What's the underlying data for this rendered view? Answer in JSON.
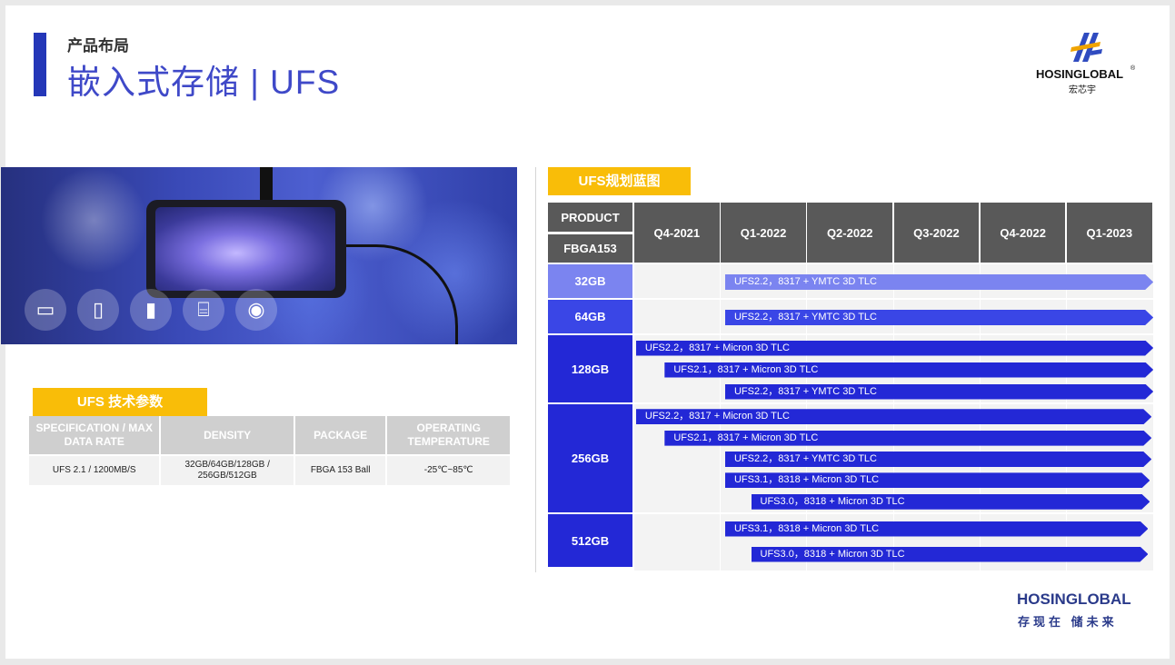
{
  "header": {
    "subtitle": "产品布局",
    "title": "嵌入式存储 | UFS"
  },
  "logo": {
    "brand": "HOSINGLOBAL",
    "registered": "®",
    "chinese": "宏芯宇"
  },
  "spec_section": {
    "tag": "UFS 技术参数",
    "columns": [
      "SPECIFICATION / MAX DATA RATE",
      "DENSITY",
      "PACKAGE",
      "OPERATING TEMPERATURE"
    ],
    "row": [
      "UFS 2.1 / 1200MB/S",
      "32GB/64GB/128GB / 256GB/512GB",
      "FBGA 153 Ball",
      "-25℃~85℃"
    ]
  },
  "roadmap": {
    "tag": "UFS规划蓝图",
    "product_label": "PRODUCT",
    "package_label": "FBGA153",
    "quarters": [
      "Q4-2021",
      "Q1-2022",
      "Q2-2022",
      "Q3-2022",
      "Q4-2022",
      "Q1-2023"
    ],
    "rows": [
      {
        "density": "32GB",
        "bars": [
          {
            "label": "UFS2.2，8317 + YMTC 3D TLC",
            "start": 1.05,
            "end": 6.0
          }
        ]
      },
      {
        "density": "64GB",
        "bars": [
          {
            "label": "UFS2.2，8317 + YMTC 3D TLC",
            "start": 1.05,
            "end": 6.0
          }
        ]
      },
      {
        "density": "128GB",
        "bars": [
          {
            "label": "UFS2.2，8317 + Micron 3D TLC",
            "start": 0.02,
            "end": 6.0
          },
          {
            "label": "UFS2.1，8317 + Micron 3D TLC",
            "start": 0.35,
            "end": 6.0
          },
          {
            "label": "UFS2.2，8317 + YMTC 3D TLC",
            "start": 1.05,
            "end": 6.0
          }
        ]
      },
      {
        "density": "256GB",
        "bars": [
          {
            "label": "UFS2.2，8317 + Micron 3D TLC",
            "start": 0.02,
            "end": 5.98
          },
          {
            "label": "UFS2.1，8317 + Micron 3D TLC",
            "start": 0.35,
            "end": 5.98
          },
          {
            "label": "UFS2.2，8317 + YMTC 3D TLC",
            "start": 1.05,
            "end": 5.98
          },
          {
            "label": "UFS3.1，8318 + Micron 3D TLC",
            "start": 1.05,
            "end": 5.96
          },
          {
            "label": "UFS3.0，8318 + Micron 3D TLC",
            "start": 1.35,
            "end": 5.96
          }
        ]
      },
      {
        "density": "512GB",
        "bars": [
          {
            "label": "UFS3.1，8318 + Micron 3D TLC",
            "start": 1.05,
            "end": 5.94
          },
          {
            "label": "UFS3.0，8318 + Micron 3D TLC",
            "start": 1.35,
            "end": 5.94
          }
        ]
      }
    ]
  },
  "colors": {
    "accent": "#2437b8",
    "tag_yellow": "#f9bd08",
    "header_gray": "#595959",
    "bar_light": "#7b84f0",
    "bar_mid": "#3a46e6",
    "bar_dark": "#2328d6",
    "title_blue": "#3f49c8"
  },
  "footer": {
    "brand": "HOSINGLOBAL",
    "slogan": "存现在  储未来"
  }
}
